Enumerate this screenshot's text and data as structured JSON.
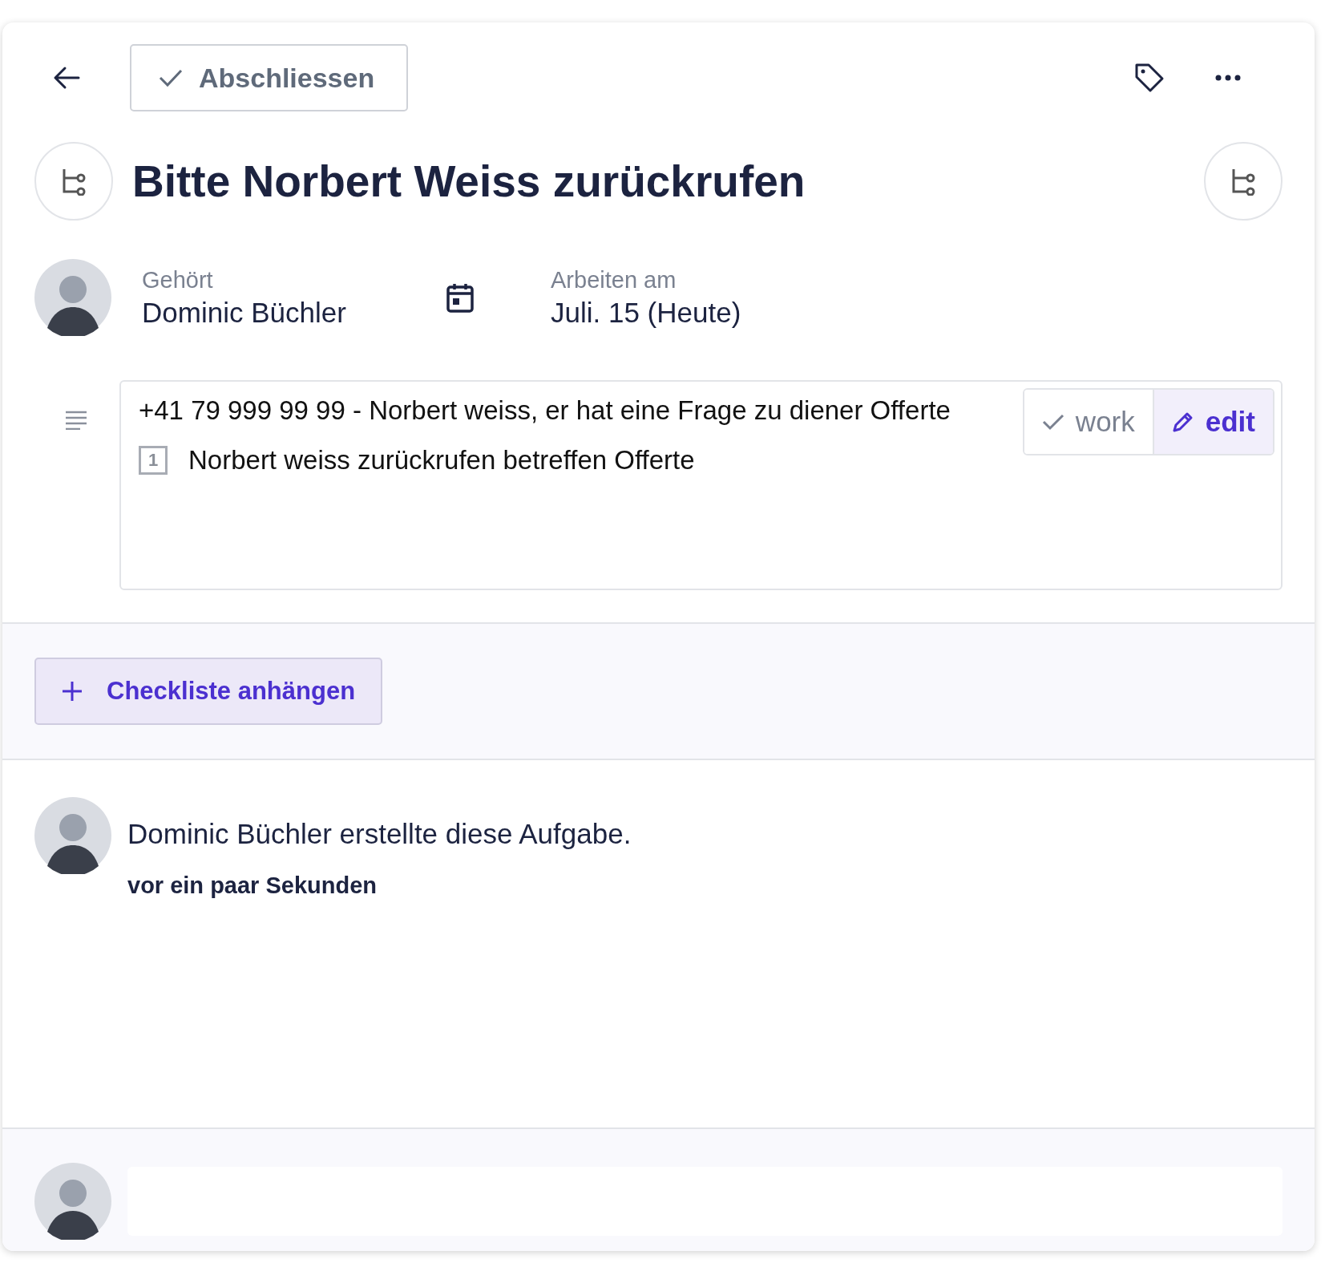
{
  "toolbar": {
    "complete_button": "Abschliessen"
  },
  "task": {
    "title": "Bitte Norbert Weiss zurückrufen"
  },
  "meta": {
    "owner_label": "Gehört",
    "owner": "Dominic Büchler",
    "date_label": "Arbeiten am",
    "date": "Juli. 15 (Heute)"
  },
  "description": {
    "lines": [
      {
        "kind": "text",
        "text": "+41 79 999 99 99 - Norbert weiss, er hat eine Frage zu diener Offerte"
      },
      {
        "kind": "numbered",
        "number": "1",
        "text": "Norbert weiss zurückrufen betreffen Offerte"
      }
    ],
    "modes": [
      {
        "label": "work",
        "selected": false
      },
      {
        "label": "edit",
        "selected": true
      }
    ]
  },
  "checklist_button": "Checkliste anhängen",
  "activity": [
    {
      "text": "Dominic Büchler erstellte diese Aufgabe.",
      "time": "vor ein paar Sekunden"
    }
  ]
}
